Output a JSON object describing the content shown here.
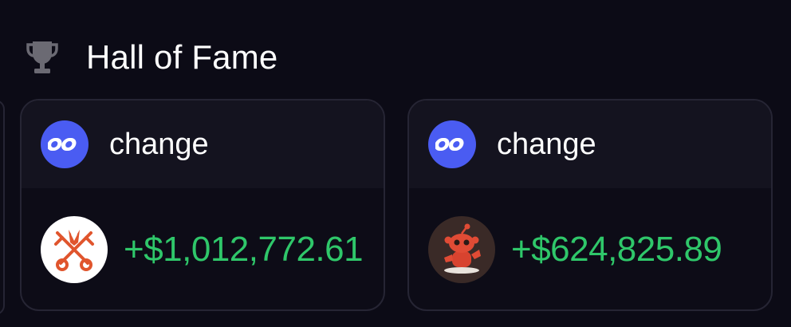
{
  "header": {
    "icon": "trophy-icon",
    "title": "Hall of Fame"
  },
  "colors": {
    "background": "#0c0b16",
    "card_top": "#14131f",
    "positive": "#2fc76a",
    "token_blue": "#4a5cf2"
  },
  "cards": [
    {
      "token_icon": "change-token-icon",
      "token_name": "change",
      "avatar": "crossed-keys-avatar",
      "amount": "+$1,012,772.61"
    },
    {
      "token_icon": "change-token-icon",
      "token_name": "change",
      "avatar": "red-robot-avatar",
      "amount": "+$624,825.89"
    }
  ]
}
